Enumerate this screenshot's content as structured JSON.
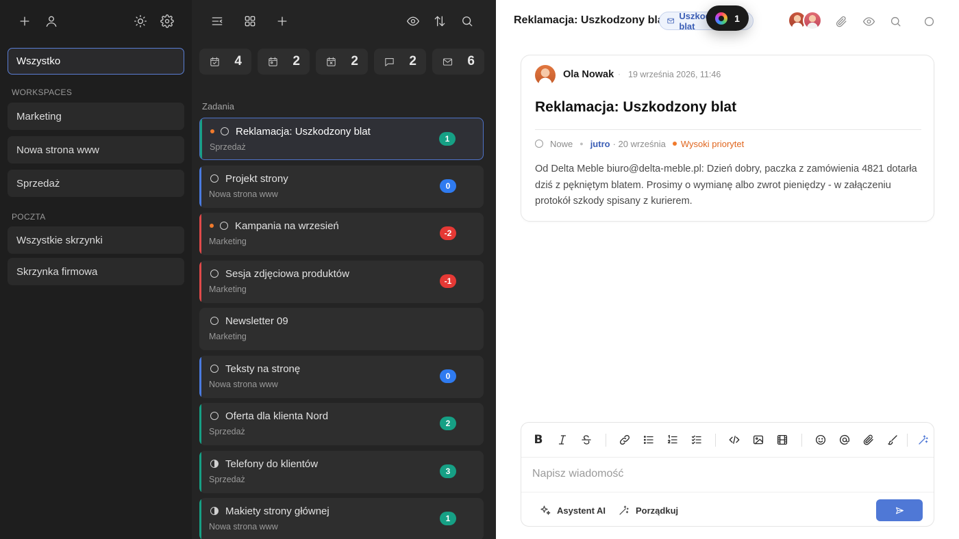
{
  "sidebar": {
    "all_label": "Wszystko",
    "workspaces_title": "WORKSPACES",
    "workspaces": [
      "Marketing",
      "Nowa strona www",
      "Sprzedaż"
    ],
    "mail_title": "POCZTA",
    "mailboxes": [
      "Wszystkie skrzynki",
      "Skrzynka firmowa"
    ]
  },
  "counters": [
    {
      "icon": "calendar-check-icon",
      "value": "4"
    },
    {
      "icon": "calendar-icon",
      "value": "2"
    },
    {
      "icon": "calendar-x-icon",
      "value": "2"
    },
    {
      "icon": "chat-icon",
      "value": "2"
    },
    {
      "icon": "mail-icon",
      "value": "6"
    }
  ],
  "tasks_label": "Zadania",
  "tasks": [
    {
      "title": "Reklamacja: Uszkodzony blat",
      "workspace": "Sprzedaż",
      "badge": "1",
      "badge_color": "#16a085",
      "bar_color": "#16a085",
      "priority": true,
      "status": "open",
      "active": true
    },
    {
      "title": "Projekt strony",
      "workspace": "Nowa strona www",
      "badge": "0",
      "badge_color": "#2f7bf0",
      "bar_color": "#4a7be0",
      "priority": false,
      "status": "open",
      "active": false
    },
    {
      "title": "Kampania na wrzesień",
      "workspace": "Marketing",
      "badge": "-2",
      "badge_color": "#e53935",
      "bar_color": "#e04a4a",
      "priority": true,
      "status": "open",
      "active": false
    },
    {
      "title": "Sesja zdjęciowa produktów",
      "workspace": "Marketing",
      "badge": "-1",
      "badge_color": "#e53935",
      "bar_color": "#e04a4a",
      "priority": false,
      "status": "open",
      "active": false
    },
    {
      "title": "Newsletter 09",
      "workspace": "Marketing",
      "badge": "",
      "badge_color": "",
      "bar_color": "",
      "priority": false,
      "status": "open",
      "active": false
    },
    {
      "title": "Teksty na stronę",
      "workspace": "Nowa strona www",
      "badge": "0",
      "badge_color": "#2f7bf0",
      "bar_color": "#4a7be0",
      "priority": false,
      "status": "open",
      "active": false
    },
    {
      "title": "Oferta dla klienta Nord",
      "workspace": "Sprzedaż",
      "badge": "2",
      "badge_color": "#16a085",
      "bar_color": "#16a085",
      "priority": false,
      "status": "open",
      "active": false
    },
    {
      "title": "Telefony do klientów",
      "workspace": "Sprzedaż",
      "badge": "3",
      "badge_color": "#16a085",
      "bar_color": "#16a085",
      "priority": false,
      "status": "in-progress",
      "active": false
    },
    {
      "title": "Makiety strony głównej",
      "workspace": "Nowa strona www",
      "badge": "1",
      "badge_color": "#16a085",
      "bar_color": "#16a085",
      "priority": false,
      "status": "in-progress",
      "active": false
    }
  ],
  "detail": {
    "header_title": "Reklamacja: Uszkodzony blat",
    "chip_label": "Uszkodzony blat",
    "notification_count": "1",
    "author": "Ola Nowak",
    "date": "19 września 2026, 11:46",
    "title": "Reklamacja: Uszkodzony blat",
    "status": "Nowe",
    "due": "jutro",
    "due_date": "· 20 września",
    "priority": "Wysoki priorytet",
    "body": "Od Delta Meble biuro@delta-meble.pl: Dzień dobry, paczka z zamówienia 4821 dotarła dziś z pękniętym blatem. Prosimy o wymianę albo zwrot pieniędzy - w załączeniu protokół szkody spisany z kurierem."
  },
  "composer": {
    "placeholder": "Napisz wiadomość",
    "ai_label": "Asystent AI",
    "tidy_label": "Porządkuj"
  },
  "colors": {
    "accent": "#4f78d6",
    "priority": "#f07a2c"
  }
}
